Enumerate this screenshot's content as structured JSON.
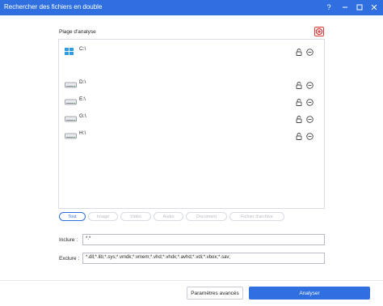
{
  "window": {
    "title": "Rechercher des fichiers en double",
    "help_icon": "?",
    "controls": [
      "help-icon",
      "minimize-icon",
      "maximize-icon",
      "close-icon"
    ]
  },
  "scan_range": {
    "label": "Plage d'analyse",
    "add_icon": "add-folder-icon",
    "drives": [
      {
        "label": "C:\\",
        "icon": "windows-drive-icon"
      },
      {
        "label": "D:\\",
        "icon": "disk-drive-icon"
      },
      {
        "label": "E:\\",
        "icon": "disk-drive-icon"
      },
      {
        "label": "G:\\",
        "icon": "disk-drive-icon"
      },
      {
        "label": "H:\\",
        "icon": "disk-drive-icon"
      }
    ]
  },
  "filters": [
    {
      "label": "Tout",
      "active": true
    },
    {
      "label": "Image",
      "active": false
    },
    {
      "label": "Vidéo",
      "active": false
    },
    {
      "label": "Audio",
      "active": false
    },
    {
      "label": "Document",
      "active": false
    },
    {
      "label": "Fichier d'archive",
      "active": false
    }
  ],
  "include": {
    "label": "Inclure :",
    "value": "*.*"
  },
  "exclude": {
    "label": "Exclure :",
    "value": "*.dll;*.lib;*.sys;*.vmdk;*.vmem;*.vhd;*.vhdx;*.avhd;*.vdi;*.vbox;*.sav;"
  },
  "footer": {
    "advanced_label": "Paramètres avancés",
    "analyze_label": "Analyser"
  },
  "colors": {
    "accent": "#2f6fdf",
    "border": "#d9dce3",
    "muted": "#b9bcc4",
    "add_icon": "#d93a3a"
  }
}
